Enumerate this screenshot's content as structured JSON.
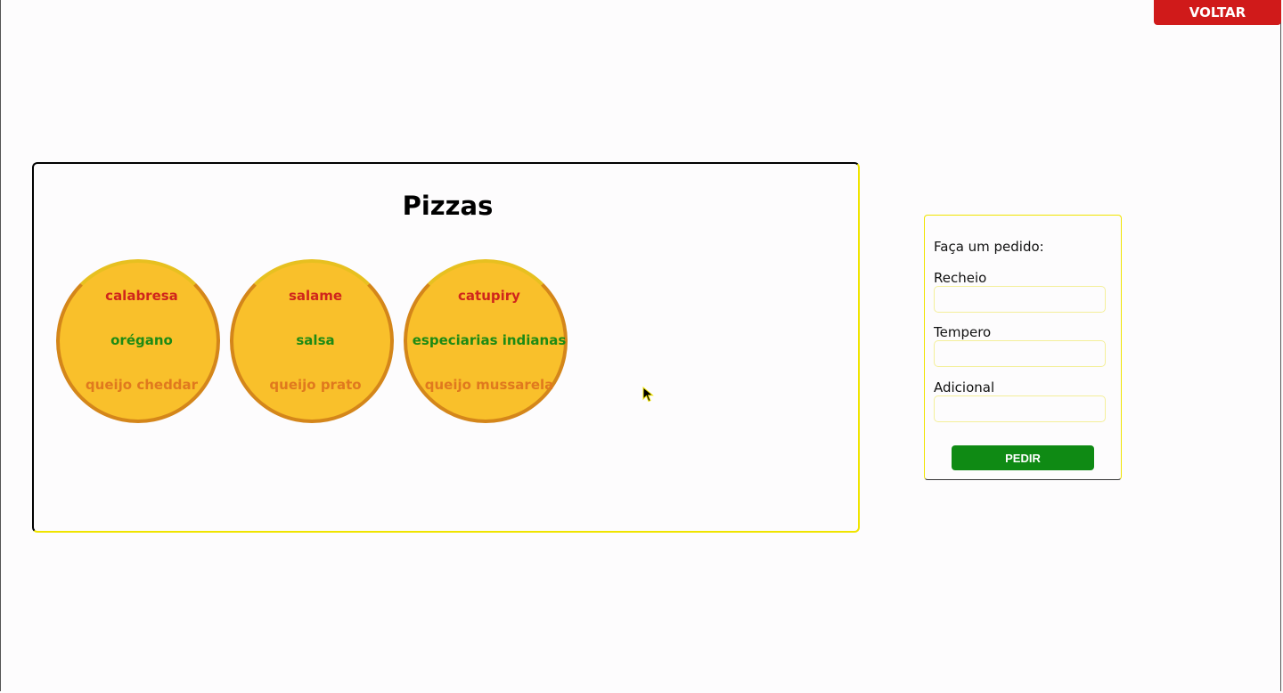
{
  "header": {
    "back_label": "VOLTAR"
  },
  "pizzas_panel": {
    "title": "Pizzas",
    "pizzas": [
      {
        "recheio": "calabresa",
        "tempero": "orégano",
        "adicional": "queijo cheddar"
      },
      {
        "recheio": "salame",
        "tempero": "salsa",
        "adicional": "queijo prato"
      },
      {
        "recheio": "catupiry",
        "tempero": "especiarias indianas",
        "adicional": "queijo mussarela"
      }
    ]
  },
  "order_form": {
    "title": "Faça um pedido:",
    "fields": [
      {
        "label": "Recheio",
        "value": ""
      },
      {
        "label": "Tempero",
        "value": ""
      },
      {
        "label": "Adicional",
        "value": ""
      }
    ],
    "submit_label": "PEDIR"
  },
  "colors": {
    "back_button": "#d01a1a",
    "submit_button": "#0f8a14",
    "pizza_fill": "#f9c02b",
    "pizza_border": "#d4861a",
    "recheio_text": "#d0261c",
    "tempero_text": "#1d8a14",
    "adicional_text": "#e0791e",
    "accent_border": "#f0e400"
  },
  "icons": {
    "cursor": "mouse-pointer-icon"
  }
}
